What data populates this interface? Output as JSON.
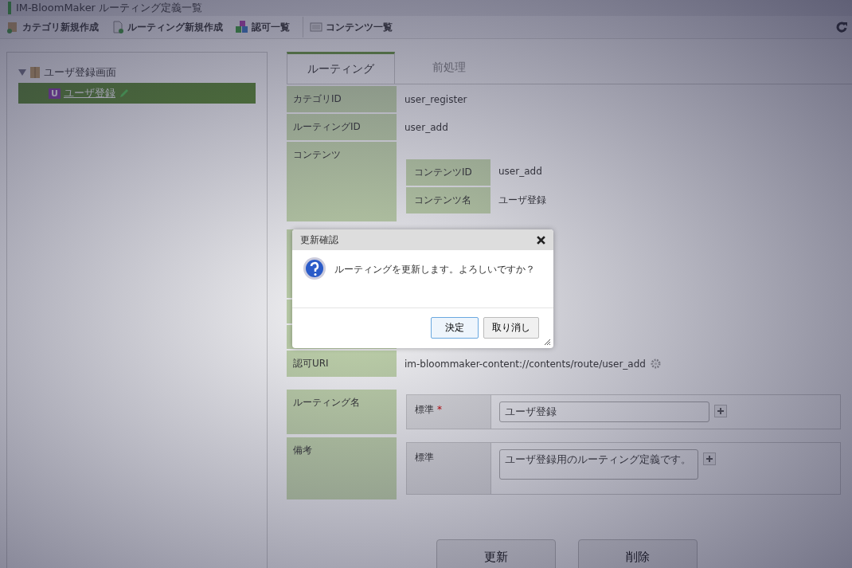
{
  "window": {
    "title": "IM-BloomMaker ルーティング定義一覧"
  },
  "toolbar": [
    {
      "label": "カテゴリ新規作成",
      "kind": "folder"
    },
    {
      "label": "ルーティング新規作成",
      "kind": "page"
    },
    {
      "label": "認可一覧",
      "kind": "blocks"
    },
    {
      "label": "コンテンツ一覧",
      "kind": "list"
    }
  ],
  "tree": [
    {
      "label": "ユーザ登録画面",
      "expanded": true,
      "children": [
        {
          "label": "ユーザ登録",
          "badge": "U",
          "selected": true
        }
      ]
    }
  ],
  "tabs": [
    {
      "label": "ルーティング",
      "selected": true
    },
    {
      "label": "前処理",
      "selected": false
    }
  ],
  "rows": [
    {
      "kind": "text",
      "label": "カテゴリID",
      "value": "user_register"
    },
    {
      "kind": "text",
      "label": "ルーティングID",
      "value": "user_add"
    },
    {
      "kind": "nested",
      "label": "コンテンツ",
      "items": [
        {
          "label": "コンテンツID",
          "value": "user_add"
        },
        {
          "label": "コンテンツ名",
          "value": "ユーザ登録"
        }
      ]
    },
    {
      "kind": "hidden"
    },
    {
      "kind": "blank"
    },
    {
      "kind": "blank"
    },
    {
      "kind": "uri",
      "label": "認可URI",
      "value": "im-bloommaker-content://contents/route/user_add"
    }
  ],
  "locale_rows": [
    {
      "label": "ルーティング名",
      "locale": "標準",
      "required_mark": "*",
      "value": "ユーザ登録",
      "multiline": false
    },
    {
      "label": "備考",
      "locale": "標準",
      "value": "ユーザ登録用のルーティング定義です。",
      "multiline": true
    }
  ],
  "buttons": [
    "更新",
    "削除"
  ],
  "dialog": {
    "title": "更新確認",
    "message": "ルーティングを更新します。よろしいですか？",
    "buttons": [
      {
        "label": "決定",
        "selected": true
      },
      {
        "label": "取り消し",
        "selected": false
      }
    ]
  }
}
